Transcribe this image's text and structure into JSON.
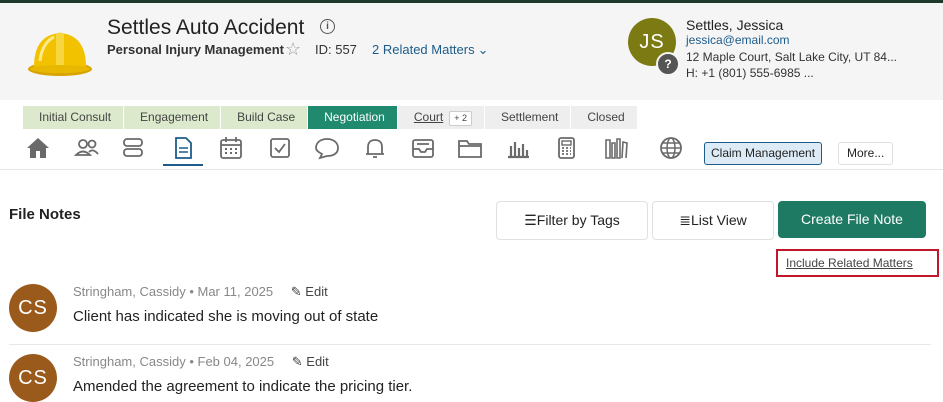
{
  "header": {
    "title": "Settles Auto Accident",
    "subtitle": "Personal Injury Management",
    "id_text": "ID: 557",
    "related_matters": "2 Related Matters",
    "client": {
      "initials": "JS",
      "name": "Settles, Jessica",
      "email": "jessica@email.com",
      "address": "12 Maple Court, Salt Lake City, UT 84...",
      "phone": "H: +1 (801) 555-6985  ..."
    }
  },
  "stages": [
    {
      "label": "Initial Consult",
      "state": "done"
    },
    {
      "label": "Engagement",
      "state": "done"
    },
    {
      "label": "Build Case",
      "state": "done"
    },
    {
      "label": "Negotiation",
      "state": "current"
    },
    {
      "label": "Court",
      "badge": "+ 2",
      "state": "future"
    },
    {
      "label": "Settlement",
      "state": "future"
    },
    {
      "label": "Closed",
      "state": "future"
    }
  ],
  "nav_icons": [
    "home-icon",
    "contacts-icon",
    "stack-icon",
    "notes-icon",
    "calendar-icon",
    "tasks-icon",
    "chat-icon",
    "bell-icon",
    "inbox-icon",
    "folder-icon",
    "chart-icon",
    "calculator-icon",
    "library-icon",
    "globe-icon"
  ],
  "nav_buttons": {
    "claim": "Claim Management",
    "more": "More..."
  },
  "main": {
    "title": "File Notes",
    "filter_btn": "Filter by Tags",
    "list_btn": "List View",
    "create_btn": "Create File Note",
    "include_link": "Include Related Matters"
  },
  "notes": [
    {
      "initials": "CS",
      "author": "Stringham, Cassidy",
      "date": "Mar 11, 2025",
      "edit": "Edit",
      "text": "Client has indicated she is moving out of state"
    },
    {
      "initials": "CS",
      "author": "Stringham, Cassidy",
      "date": "Feb 04, 2025",
      "edit": "Edit",
      "text": "Amended the agreement to indicate the pricing tier."
    }
  ],
  "colors": {
    "accent": "#1f7a64",
    "link": "#1d5c8a",
    "stage_done": "#dde9cc",
    "stage_current": "#1f8a6e",
    "highlight": "#c0182a"
  }
}
